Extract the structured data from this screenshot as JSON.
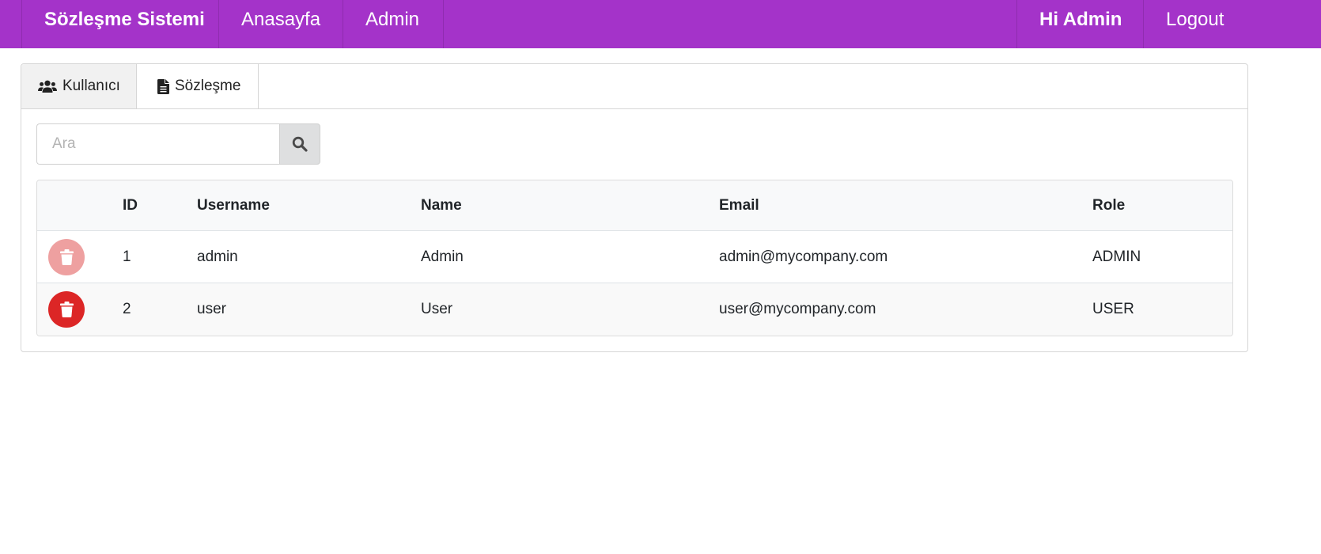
{
  "navbar": {
    "brand": "Sözleşme Sistemi",
    "home": "Anasayfa",
    "admin": "Admin",
    "greeting": "Hi Admin",
    "logout": "Logout"
  },
  "tabs": [
    {
      "label": "Kullanıcı",
      "icon": "users-icon",
      "active": true
    },
    {
      "label": "Sözleşme",
      "icon": "file-icon",
      "active": false
    }
  ],
  "search": {
    "placeholder": "Ara",
    "value": "",
    "button_icon": "search-icon"
  },
  "table": {
    "headers": [
      "",
      "ID",
      "Username",
      "Name",
      "Email",
      "Role"
    ],
    "rows": [
      {
        "id": "1",
        "username": "admin",
        "name": "Admin",
        "email": "admin@mycompany.com",
        "role": "ADMIN",
        "delete_enabled": false
      },
      {
        "id": "2",
        "username": "user",
        "name": "User",
        "email": "user@mycompany.com",
        "role": "USER",
        "delete_enabled": true
      }
    ]
  },
  "colors": {
    "navbar": "#a433c9",
    "delete_active": "#dc2626",
    "delete_disabled": "#eea0a0",
    "header_bg": "#f8f9fa"
  }
}
